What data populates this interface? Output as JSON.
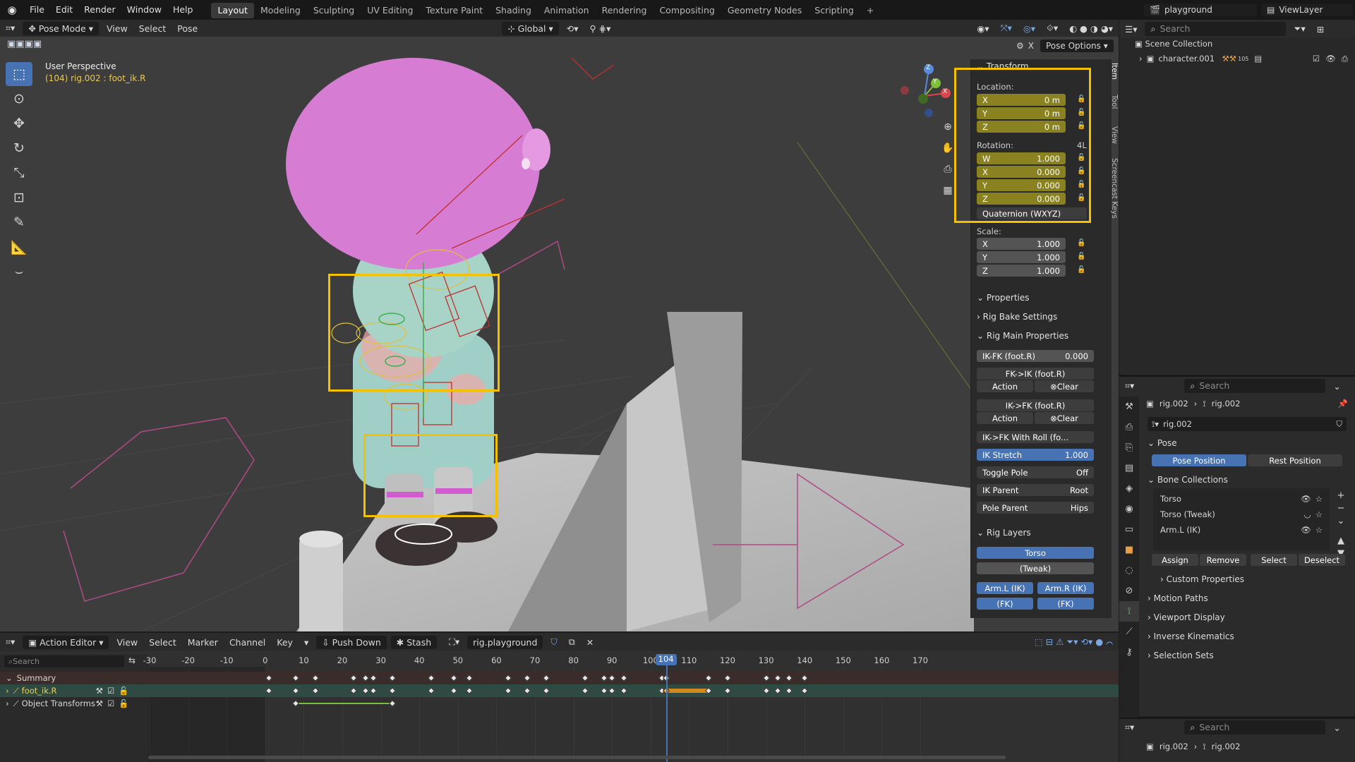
{
  "top_menu": {
    "blender_logo": "blender-logo",
    "items": [
      "File",
      "Edit",
      "Render",
      "Window",
      "Help"
    ]
  },
  "workspace_tabs": [
    "Layout",
    "Modeling",
    "Sculpting",
    "UV Editing",
    "Texture Paint",
    "Shading",
    "Animation",
    "Rendering",
    "Compositing",
    "Geometry Nodes",
    "Scripting"
  ],
  "active_tab": "Layout",
  "add_tab": "+",
  "scene": {
    "name": "playground",
    "view_layer": "ViewLayer"
  },
  "viewport_header": {
    "mode": "Pose Mode",
    "menus": [
      "View",
      "Select",
      "Pose"
    ],
    "orientation": "Global",
    "pose_options": "Pose Options"
  },
  "viewport": {
    "title": "User Perspective",
    "subtitle": "(104) rig.002 : foot_ik.R",
    "gizmo": {
      "x": "X",
      "y": "Y",
      "z": "Z"
    }
  },
  "side_tabs": [
    "Item",
    "Tool",
    "View",
    "Screencast Keys"
  ],
  "n_panel": {
    "transform_title": "Transform",
    "location_label": "Location:",
    "location": [
      {
        "axis": "X",
        "value": "0 m"
      },
      {
        "axis": "Y",
        "value": "0 m"
      },
      {
        "axis": "Z",
        "value": "0 m"
      }
    ],
    "rotation_label": "Rotation:",
    "rotation_mode_short": "4L",
    "rotation": [
      {
        "axis": "W",
        "value": "1.000"
      },
      {
        "axis": "X",
        "value": "0.000"
      },
      {
        "axis": "Y",
        "value": "0.000"
      },
      {
        "axis": "Z",
        "value": "0.000"
      }
    ],
    "rotation_mode": "Quaternion (WXYZ)",
    "scale_label": "Scale:",
    "scale": [
      {
        "axis": "X",
        "value": "1.000"
      },
      {
        "axis": "Y",
        "value": "1.000"
      },
      {
        "axis": "Z",
        "value": "1.000"
      }
    ],
    "properties_title": "Properties",
    "rig_bake": "Rig Bake Settings",
    "rig_main": "Rig Main Properties",
    "ikfk_label": "IK-FK (foot.R)",
    "ikfk_value": "0.000",
    "fk_to_ik": "FK->IK (foot.R)",
    "ik_to_fk": "IK->FK (foot.R)",
    "action": "Action",
    "clear": "Clear",
    "ik_fk_roll": "IK->FK With Roll (fo...",
    "ik_stretch_label": "IK Stretch",
    "ik_stretch_value": "1.000",
    "toggle_pole_label": "Toggle Pole",
    "toggle_pole_value": "Off",
    "ik_parent_label": "IK Parent",
    "ik_parent_value": "Root",
    "pole_parent_label": "Pole Parent",
    "pole_parent_value": "Hips",
    "rig_layers_title": "Rig Layers",
    "layer_torso": "Torso",
    "layer_tweak": "(Tweak)",
    "layer_arm_l": "Arm.L (IK)",
    "layer_arm_r": "Arm.R (IK)",
    "layer_fk_l": "(FK)",
    "layer_fk_r": "(FK)"
  },
  "outliner": {
    "search_placeholder": "Search",
    "scene_collection": "Scene Collection",
    "item": "character.001",
    "item_badge": "105"
  },
  "properties": {
    "search_placeholder": "Search",
    "breadcrumb_obj": "rig.002",
    "breadcrumb_data": "rig.002",
    "armature_name": "rig.002",
    "pose_title": "Pose",
    "pose_position": "Pose Position",
    "rest_position": "Rest Position",
    "bone_collections_title": "Bone Collections",
    "bone_collections": [
      "Torso",
      "Torso (Tweak)",
      "Arm.L (IK)"
    ],
    "assign": "Assign",
    "remove": "Remove",
    "select": "Select",
    "deselect": "Deselect",
    "sections": [
      "Custom Properties",
      "Motion Paths",
      "Viewport Display",
      "Inverse Kinematics",
      "Selection Sets"
    ],
    "bottom_breadcrumb_obj": "rig.002",
    "bottom_breadcrumb_data": "rig.002",
    "bottom_search_placeholder": "Search"
  },
  "action_editor": {
    "editor": "Action Editor",
    "menus": [
      "View",
      "Select",
      "Marker",
      "Channel",
      "Key"
    ],
    "push_down": "Push Down",
    "stash": "Stash",
    "action_name": "rig.playground",
    "search_placeholder": "Search",
    "current_frame": "104",
    "channels": [
      "Summary",
      "foot_ik.R",
      "Object Transforms"
    ],
    "ticks": [
      -30,
      -20,
      -10,
      0,
      10,
      20,
      30,
      40,
      50,
      60,
      70,
      80,
      90,
      100,
      110,
      120,
      130,
      140,
      150,
      160,
      170
    ],
    "summary_keys": [
      1,
      8,
      13,
      23,
      26,
      28,
      33,
      43,
      49,
      53,
      63,
      68,
      73,
      83,
      88,
      90,
      93,
      103,
      104,
      115,
      120,
      130,
      133,
      136,
      140
    ],
    "foot_keys": [
      1,
      8,
      13,
      23,
      26,
      28,
      33,
      43,
      49,
      53,
      63,
      68,
      73,
      83,
      88,
      90,
      93,
      103,
      104,
      115,
      120,
      130,
      133,
      136,
      140
    ],
    "selected_keys": [
      104
    ],
    "hold_range": [
      104,
      115
    ],
    "object_keys": [
      8,
      33
    ]
  },
  "colors": {
    "accent": "#4772b3",
    "highlight": "#f3c100",
    "keyframe_selected": "#ffb13a",
    "character_head": "#d97ad6"
  }
}
